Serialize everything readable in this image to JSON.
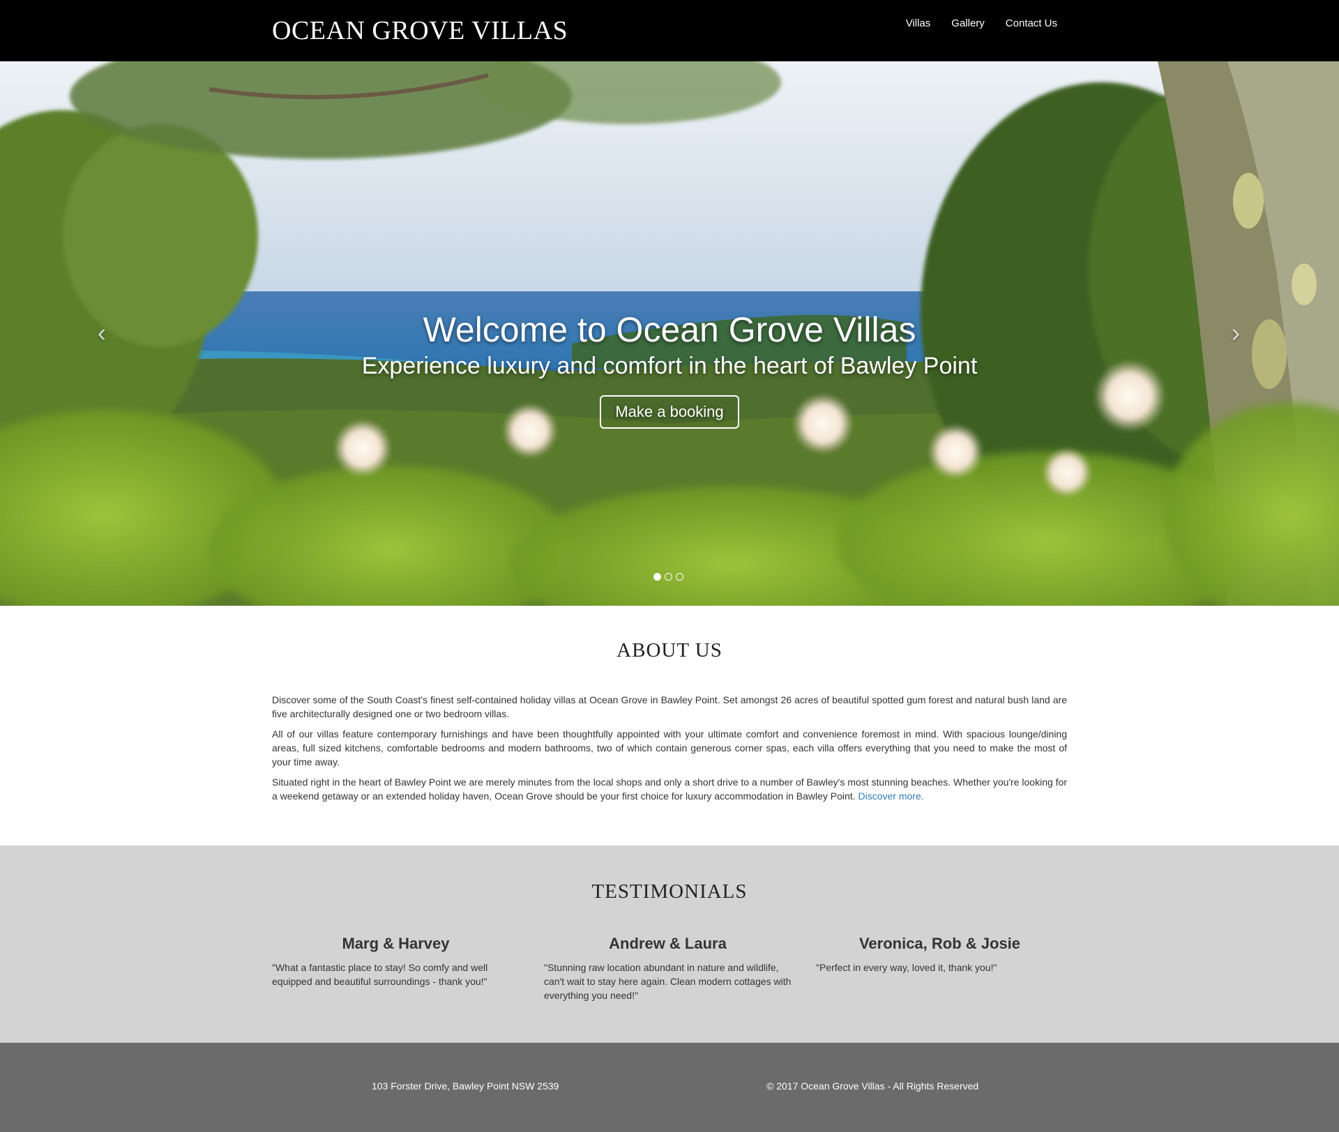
{
  "navbar": {
    "brand": "OCEAN GROVE VILLAS",
    "links": [
      "Villas",
      "Gallery",
      "Contact Us"
    ]
  },
  "hero": {
    "title": "Welcome to Ocean Grove Villas",
    "subtitle": "Experience luxury and comfort in the heart of Bawley Point",
    "button": "Make a booking",
    "arrow_left_icon": "chevron-left-icon",
    "arrow_right_icon": "chevron-right-icon",
    "slides_total": 3,
    "active_slide": 1
  },
  "about": {
    "title": "ABOUT US",
    "p1": "Discover some of the South Coast's finest self-contained holiday villas at Ocean Grove in Bawley Point. Set amongst 26 acres of beautiful spotted gum forest and natural bush land are five architecturally designed one or two bedroom villas.",
    "p2": "All of our villas feature contemporary furnishings and have been thoughtfully appointed with your ultimate comfort and convenience foremost in mind. With spacious lounge/dining areas, full sized kitchens, comfortable bedrooms and modern bathrooms, two of which contain generous corner spas, each villa offers everything that you need to make the most of your time away.",
    "p3": "Situated right in the heart of Bawley Point we are merely minutes from the local shops and only a short drive to a number of Bawley's most stunning beaches. Whether you're looking for a weekend getaway or an extended holiday haven, Ocean Grove should be your first choice for luxury accommodation in Bawley Point.",
    "link": "Discover more."
  },
  "testimonials": {
    "title": "TESTIMONIALS",
    "items": [
      {
        "name": "Marg & Harvey",
        "quote": "\"What a fantastic place to stay! So comfy and well equipped and beautiful surroundings - thank you!\""
      },
      {
        "name": "Andrew & Laura",
        "quote": "\"Stunning raw location abundant in nature and wildlife, can't wait to stay here again. Clean modern cottages with everything you need!\""
      },
      {
        "name": "Veronica, Rob & Josie",
        "quote": "\"Perfect in every way, loved it, thank you!\""
      }
    ]
  },
  "footer": {
    "address": "103 Forster Drive, Bawley Point NSW 2539",
    "copyright": "© 2017 Ocean Grove Villas - All Rights Reserved"
  }
}
